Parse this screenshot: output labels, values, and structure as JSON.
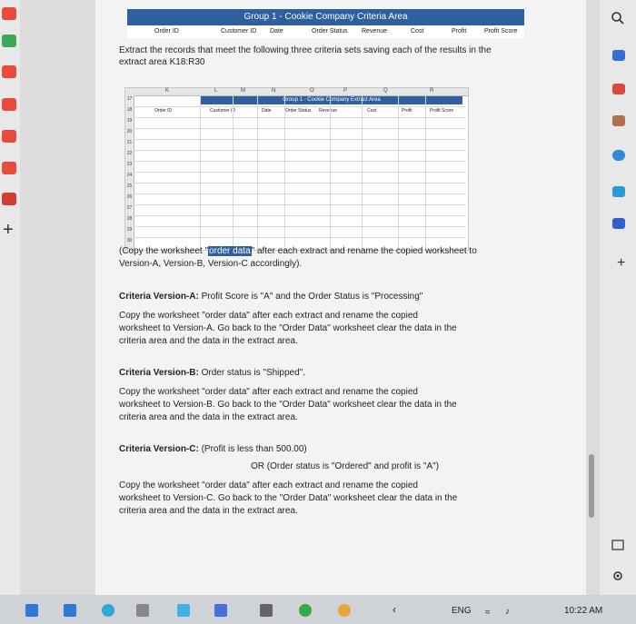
{
  "criteria_area": {
    "title": "Group 1 - Cookie Company Criteria Area",
    "headers": [
      "Order ID",
      "Customer ID",
      "Date",
      "Order Status",
      "Revenue",
      "Cost",
      "Profit",
      "Profit Score"
    ]
  },
  "instructions": {
    "extract_line1": "Extract the records that meet the following three criteria sets saving each of the results in the",
    "extract_line2": "extract area K18:R30"
  },
  "sheet": {
    "col_letters": [
      "K",
      "L",
      "M",
      "N",
      "O",
      "P",
      "Q",
      "R"
    ],
    "title": "Group 1 - Cookie Company Extract Area",
    "headers": [
      "Order ID",
      "Customer ID",
      "Date",
      "Order Status",
      "Revenue",
      "Cost",
      "Profit",
      "Profit Score"
    ],
    "row_numbers": [
      "17",
      "18",
      "19",
      "20",
      "21",
      "22",
      "23",
      "24",
      "25",
      "26",
      "27",
      "28",
      "29",
      "30"
    ]
  },
  "copy_note": {
    "prefix": "(Copy the worksheet \"",
    "highlight": "order data",
    "suffix": "\" after each extract and rename the copied worksheet to",
    "line2": "Version-A, Version-B, Version-C accordingly)."
  },
  "version_a": {
    "label": "Criteria Version-A:",
    "criteria": " Profit Score is \"A\" and the Order Status is \"Processing\"",
    "line1": "Copy the worksheet \"order data\" after each extract and rename the copied",
    "line2": "worksheet to Version-A. Go back to the \"Order Data\" worksheet clear the data in the",
    "line3": "criteria area and the data in the extract area."
  },
  "version_b": {
    "label": "Criteria Version-B:",
    "criteria": " Order status is \"Shipped\".",
    "line1": "Copy the worksheet \"order data\" after each extract and rename the copied",
    "line2": "worksheet to Version-B. Go back to the \"Order Data\" worksheet clear the data in the",
    "line3": "criteria area and the data in the extract area."
  },
  "version_c": {
    "label": "Criteria Version-C:",
    "criteria": " (Profit is less than 500.00)",
    "or_line": "OR    (Order status is \"Ordered\" and profit is \"A\")",
    "line1": "Copy the worksheet \"order data\" after each extract and rename the copied",
    "line2": "worksheet to Version-C. Go back to the \"Order Data\" worksheet clear the data in the",
    "line3": "criteria area and the data in the extract area."
  },
  "taskbar": {
    "language": "ENG",
    "time": "10:22 AM"
  },
  "icons": {
    "search": "search-icon",
    "add": "plus-icon",
    "settings": "gear-icon",
    "window": "window-icon"
  },
  "colors": {
    "header_blue": "#2e5f9e",
    "page": "#f3f3f3"
  }
}
